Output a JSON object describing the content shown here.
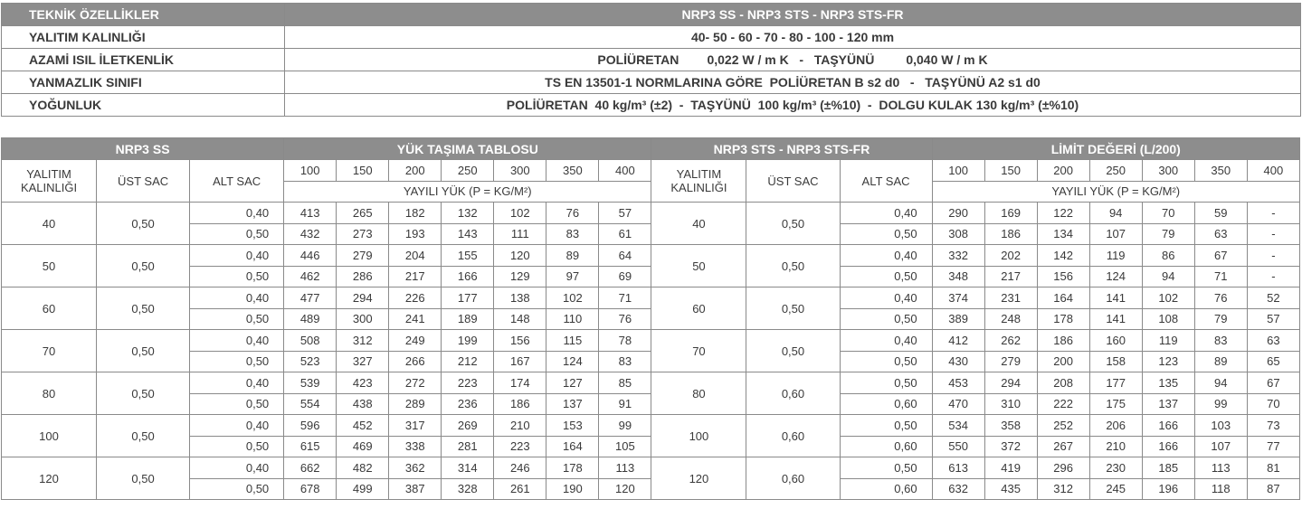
{
  "spec": {
    "header": {
      "label": "TEKNİK ÖZELLİKLER",
      "value": "NRP3 SS - NRP3 STS - NRP3 STS-FR"
    },
    "rows": [
      {
        "label": "YALITIM KALINLIĞI",
        "value": "40- 50 - 60 - 70 - 80 - 100 - 120 mm"
      },
      {
        "label": "AZAMİ ISIL İLETKENLİK",
        "value": "POLİÜRETAN        0,022 W / m K   -   TAŞYÜNÜ         0,040 W / m K"
      },
      {
        "label": "YANMAZLIK SINIFI",
        "value": "TS EN 13501-1 NORMLARINA GÖRE  POLİÜRETAN B s2 d0   -   TAŞYÜNÜ A2 s1 d0"
      },
      {
        "label": "YOĞUNLUK",
        "value": "POLİÜRETAN  40 kg/m³ (±2)  -  TAŞYÜNÜ  100 kg/m³ (±%10)  -  DOLGU KULAK 130 kg/m³ (±%10)"
      }
    ]
  },
  "load": {
    "groups": [
      "NRP3 SS",
      "YÜK TAŞIMA TABLOSU",
      "NRP3 STS - NRP3 STS-FR",
      "LİMİT DEĞERİ (L/200)"
    ],
    "col_thickness": "YALITIM KALINLIĞI",
    "col_top": "ÜST SAC",
    "col_bottom": "ALT SAC",
    "spans": [
      "100",
      "150",
      "200",
      "250",
      "300",
      "350",
      "400"
    ],
    "load_label": "YAYILI YÜK (P = KG/M²)",
    "left": [
      {
        "thk": "40",
        "ust": "0,50",
        "rows": [
          [
            "0,40",
            "413",
            "265",
            "182",
            "132",
            "102",
            "76",
            "57"
          ],
          [
            "0,50",
            "432",
            "273",
            "193",
            "143",
            "111",
            "83",
            "61"
          ]
        ]
      },
      {
        "thk": "50",
        "ust": "0,50",
        "rows": [
          [
            "0,40",
            "446",
            "279",
            "204",
            "155",
            "120",
            "89",
            "64"
          ],
          [
            "0,50",
            "462",
            "286",
            "217",
            "166",
            "129",
            "97",
            "69"
          ]
        ]
      },
      {
        "thk": "60",
        "ust": "0,50",
        "rows": [
          [
            "0,40",
            "477",
            "294",
            "226",
            "177",
            "138",
            "102",
            "71"
          ],
          [
            "0,50",
            "489",
            "300",
            "241",
            "189",
            "148",
            "110",
            "76"
          ]
        ]
      },
      {
        "thk": "70",
        "ust": "0,50",
        "rows": [
          [
            "0,40",
            "508",
            "312",
            "249",
            "199",
            "156",
            "115",
            "78"
          ],
          [
            "0,50",
            "523",
            "327",
            "266",
            "212",
            "167",
            "124",
            "83"
          ]
        ]
      },
      {
        "thk": "80",
        "ust": "0,50",
        "rows": [
          [
            "0,40",
            "539",
            "423",
            "272",
            "223",
            "174",
            "127",
            "85"
          ],
          [
            "0,50",
            "554",
            "438",
            "289",
            "236",
            "186",
            "137",
            "91"
          ]
        ]
      },
      {
        "thk": "100",
        "ust": "0,50",
        "rows": [
          [
            "0,40",
            "596",
            "452",
            "317",
            "269",
            "210",
            "153",
            "99"
          ],
          [
            "0,50",
            "615",
            "469",
            "338",
            "281",
            "223",
            "164",
            "105"
          ]
        ]
      },
      {
        "thk": "120",
        "ust": "0,50",
        "rows": [
          [
            "0,40",
            "662",
            "482",
            "362",
            "314",
            "246",
            "178",
            "113"
          ],
          [
            "0,50",
            "678",
            "499",
            "387",
            "328",
            "261",
            "190",
            "120"
          ]
        ]
      }
    ],
    "right": [
      {
        "thk": "40",
        "ust": "0,50",
        "rows": [
          [
            "0,40",
            "290",
            "169",
            "122",
            "94",
            "70",
            "59",
            "-"
          ],
          [
            "0,50",
            "308",
            "186",
            "134",
            "107",
            "79",
            "63",
            "-"
          ]
        ]
      },
      {
        "thk": "50",
        "ust": "0,50",
        "rows": [
          [
            "0,40",
            "332",
            "202",
            "142",
            "119",
            "86",
            "67",
            "-"
          ],
          [
            "0,50",
            "348",
            "217",
            "156",
            "124",
            "94",
            "71",
            "-"
          ]
        ]
      },
      {
        "thk": "60",
        "ust": "0,50",
        "rows": [
          [
            "0,40",
            "374",
            "231",
            "164",
            "141",
            "102",
            "76",
            "52"
          ],
          [
            "0,50",
            "389",
            "248",
            "178",
            "141",
            "108",
            "79",
            "57"
          ]
        ]
      },
      {
        "thk": "70",
        "ust": "0,50",
        "rows": [
          [
            "0,40",
            "412",
            "262",
            "186",
            "160",
            "119",
            "83",
            "63"
          ],
          [
            "0,50",
            "430",
            "279",
            "200",
            "158",
            "123",
            "89",
            "65"
          ]
        ]
      },
      {
        "thk": "80",
        "ust": "0,60",
        "rows": [
          [
            "0,50",
            "453",
            "294",
            "208",
            "177",
            "135",
            "94",
            "67"
          ],
          [
            "0,60",
            "470",
            "310",
            "222",
            "175",
            "137",
            "99",
            "70"
          ]
        ]
      },
      {
        "thk": "100",
        "ust": "0,60",
        "rows": [
          [
            "0,50",
            "534",
            "358",
            "252",
            "206",
            "166",
            "103",
            "73"
          ],
          [
            "0,60",
            "550",
            "372",
            "267",
            "210",
            "166",
            "107",
            "77"
          ]
        ]
      },
      {
        "thk": "120",
        "ust": "0,60",
        "rows": [
          [
            "0,50",
            "613",
            "419",
            "296",
            "230",
            "185",
            "113",
            "81"
          ],
          [
            "0,60",
            "632",
            "435",
            "312",
            "245",
            "196",
            "118",
            "87"
          ]
        ]
      }
    ]
  }
}
